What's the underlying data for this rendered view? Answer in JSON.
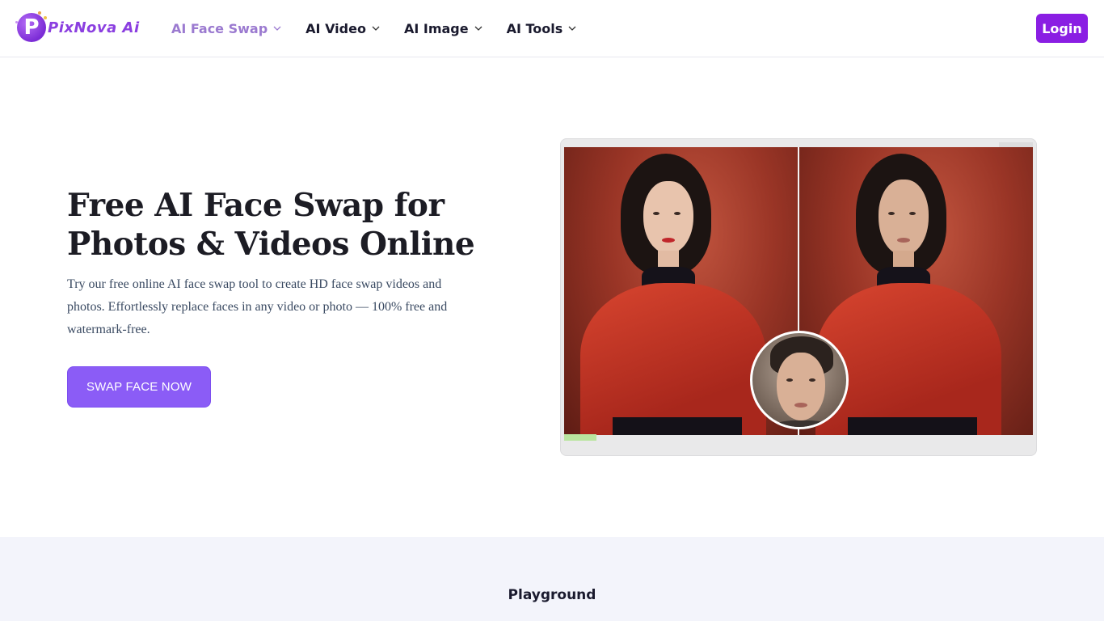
{
  "brand": {
    "logo_letter": "P",
    "logo_text": "PixNova Ai",
    "accent": "#8a1ee3"
  },
  "nav": {
    "items": [
      {
        "label": "AI Face Swap",
        "active": true
      },
      {
        "label": "AI Video",
        "active": false
      },
      {
        "label": "AI Image",
        "active": false
      },
      {
        "label": "AI Tools",
        "active": false
      }
    ],
    "login_label": "Login"
  },
  "hero": {
    "title": "Free AI Face Swap for Photos & Videos Online",
    "description": "Try our free online AI face swap tool to create HD face swap videos and photos. Effortlessly replace faces in any video or photo — 100% free and watermark-free.",
    "cta_label": "SWAP FACE NOW"
  },
  "section": {
    "title": "Playground"
  }
}
